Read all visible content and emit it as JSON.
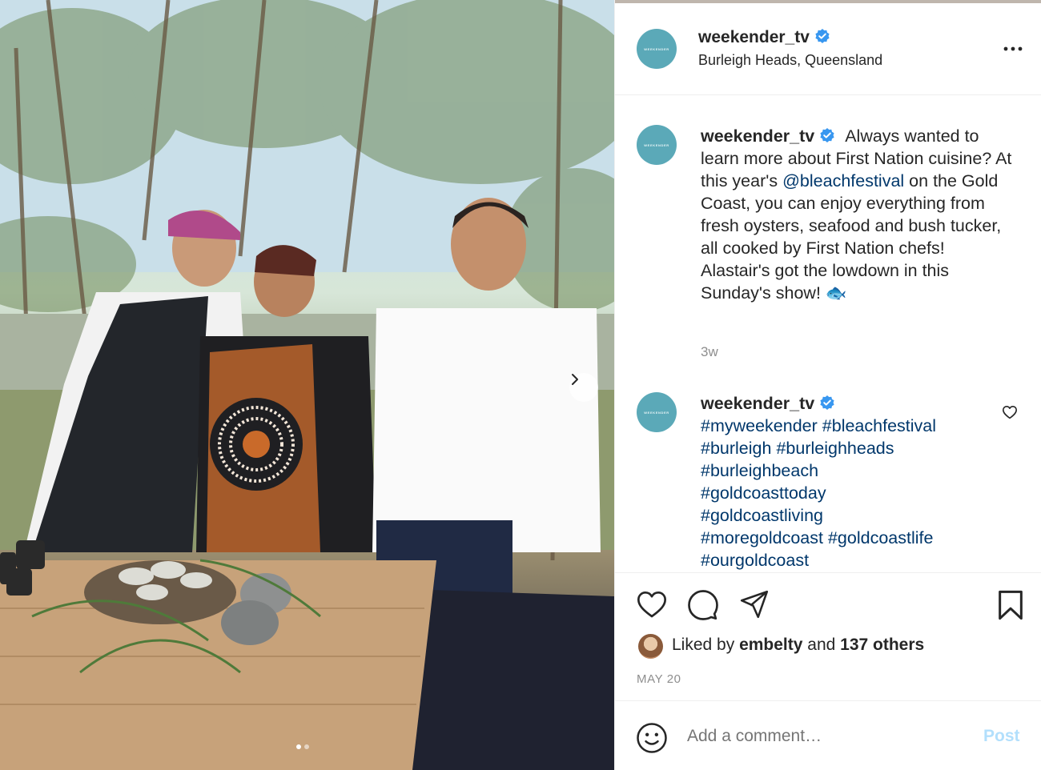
{
  "photo": {
    "description_icon": "photo-post",
    "carousel_dots": 2,
    "active_dot": 0
  },
  "header": {
    "username": "weekender_tv",
    "location": "Burleigh Heads, Queensland",
    "avatar_text": "WEEKENDER"
  },
  "caption": {
    "username": "weekender_tv",
    "text_before": "Always wanted to learn more about First Nation cuisine? At this year's ",
    "mention": "@bleachfestival",
    "text_after": " on the Gold Coast, you can enjoy everything from fresh oysters, seafood and bush tucker, all cooked by First Nation chefs! Alastair's got the lowdown in this Sunday's show! 🐟",
    "time": "3w"
  },
  "hashtag_comment": {
    "username": "weekender_tv",
    "tags": [
      "#myweekender",
      "#bleachfestival",
      "#burleigh",
      "#burleighheads",
      "#burleighbeach",
      "#goldcoasttoday",
      "#goldcoastliving",
      "#moregoldcoast",
      "#goldcoastlife",
      "#ourgoldcoast"
    ]
  },
  "actions": {
    "liked_prefix": "Liked by ",
    "liked_user": "embelty",
    "liked_and": " and ",
    "liked_others": "137 others",
    "date": "MAY 20"
  },
  "add_comment": {
    "placeholder": "Add a comment…",
    "post_label": "Post"
  },
  "colors": {
    "avatar": "#5ba9b8",
    "verified": "#3897f0",
    "link": "#00376b",
    "post_disabled": "#b2dffc"
  }
}
